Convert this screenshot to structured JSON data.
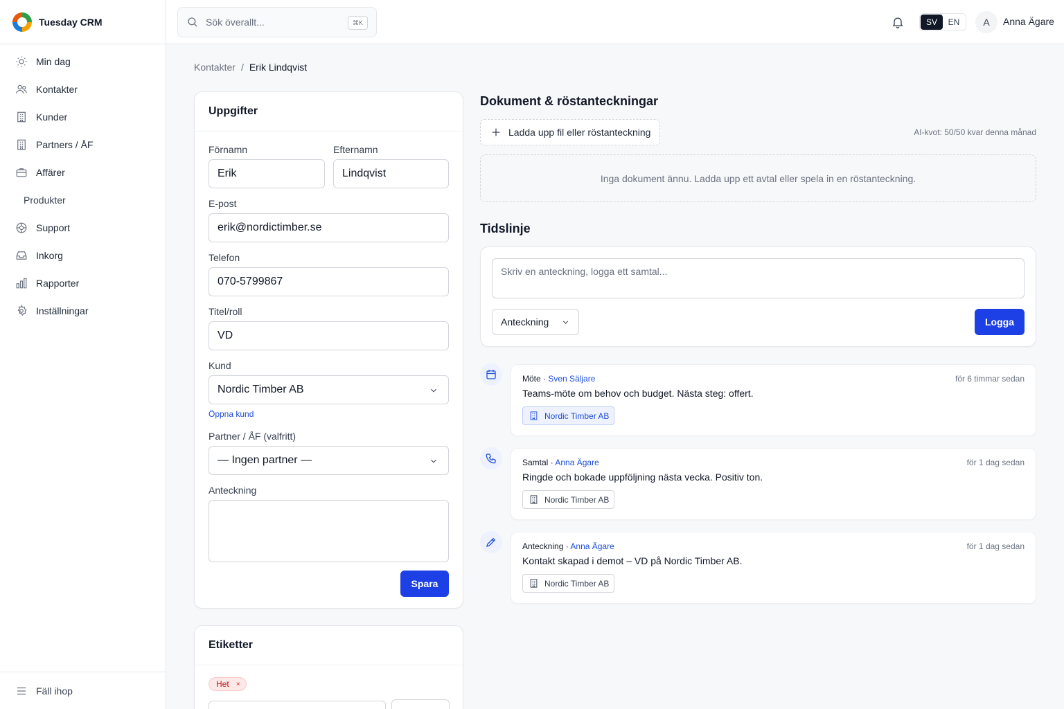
{
  "app": {
    "name": "Tuesday CRM"
  },
  "sidebar": {
    "items": [
      {
        "label": "Min dag",
        "icon": "sun-icon"
      },
      {
        "label": "Kontakter",
        "icon": "users-icon"
      },
      {
        "label": "Kunder",
        "icon": "building-icon"
      },
      {
        "label": "Partners / ÅF",
        "icon": "building-icon"
      },
      {
        "label": "Affärer",
        "icon": "briefcase-icon"
      },
      {
        "label": "Produkter",
        "icon": ""
      },
      {
        "label": "Support",
        "icon": "lifebuoy-icon"
      },
      {
        "label": "Inkorg",
        "icon": "inbox-icon"
      },
      {
        "label": "Rapporter",
        "icon": "bar-chart-icon"
      },
      {
        "label": "Inställningar",
        "icon": "gear-icon"
      }
    ],
    "collapse_label": "Fäll ihop"
  },
  "topbar": {
    "search_placeholder": "Sök överallt...",
    "shortcut": "⌘K",
    "lang_sv": "SV",
    "lang_en": "EN",
    "active_lang": "SV",
    "avatar_initial": "A",
    "username": "Anna Ägare"
  },
  "breadcrumb": {
    "parent": "Kontakter",
    "separator": "/",
    "current": "Erik Lindqvist"
  },
  "details": {
    "title": "Uppgifter",
    "first_name_label": "Förnamn",
    "first_name": "Erik",
    "last_name_label": "Efternamn",
    "last_name": "Lindqvist",
    "email_label": "E-post",
    "email": "erik@nordictimber.se",
    "phone_label": "Telefon",
    "phone": "070-5799867",
    "title_label": "Titel/roll",
    "title_value": "VD",
    "customer_label": "Kund",
    "customer": "Nordic Timber AB",
    "open_customer_link": "Öppna kund",
    "partner_label": "Partner / ÅF (valfritt)",
    "partner": "— Ingen partner —",
    "note_label": "Anteckning",
    "note": "",
    "save_label": "Spara"
  },
  "tags": {
    "title": "Etiketter",
    "items": [
      {
        "label": "Het",
        "remove": "×"
      }
    ]
  },
  "documents": {
    "title": "Dokument & röstanteckningar",
    "upload_label": "Ladda upp fil eller röstanteckning",
    "quota": "AI-kvot: 50/50 kvar denna månad",
    "empty_text": "Inga dokument ännu. Ladda upp ett avtal eller spela in en röstanteckning."
  },
  "timeline": {
    "title": "Tidslinje",
    "input_placeholder": "Skriv en anteckning, logga ett samtal...",
    "type_selected": "Anteckning",
    "log_label": "Logga",
    "entries": [
      {
        "type": "Möte",
        "author": "Sven Säljare",
        "time": "för 6 timmar sedan",
        "text": "Teams-möte om behov och budget. Nästa steg: offert.",
        "company": "Nordic Timber AB",
        "icon": "calendar-icon"
      },
      {
        "type": "Samtal",
        "author": "Anna Ägare",
        "time": "för 1 dag sedan",
        "text": "Ringde och bokade uppföljning nästa vecka. Positiv ton.",
        "company": "Nordic Timber AB",
        "icon": "phone-icon"
      },
      {
        "type": "Anteckning",
        "author": "Anna Ägare",
        "time": "för 1 dag sedan",
        "text": "Kontakt skapad i demot – VD på Nordic Timber AB.",
        "company": "Nordic Timber AB",
        "icon": "pencil-icon"
      }
    ]
  },
  "colors": {
    "primary": "#1d3fe6",
    "link": "#1d4ed8",
    "tag_bg": "#fde8e8",
    "tag_text": "#b91c1c"
  }
}
